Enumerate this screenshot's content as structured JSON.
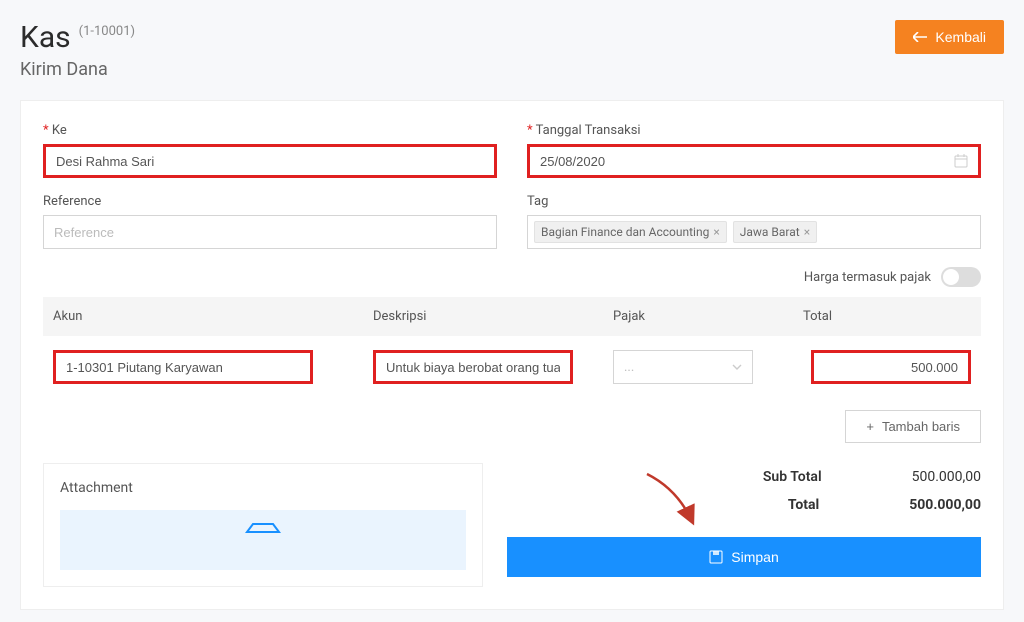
{
  "header": {
    "title": "Kas",
    "code": "(1-10001)",
    "subtitle": "Kirim Dana",
    "back_label": "Kembali"
  },
  "form": {
    "ke_label": "Ke",
    "ke_value": "Desi Rahma Sari",
    "tanggal_label": "Tanggal Transaksi",
    "tanggal_value": "25/08/2020",
    "reference_label": "Reference",
    "reference_placeholder": "Reference",
    "tag_label": "Tag",
    "tags": [
      "Bagian Finance dan Accounting",
      "Jawa Barat"
    ]
  },
  "toggle": {
    "label": "Harga termasuk pajak"
  },
  "table": {
    "head": {
      "akun": "Akun",
      "deskripsi": "Deskripsi",
      "pajak": "Pajak",
      "total": "Total"
    },
    "row": {
      "akun": "1-10301 Piutang Karyawan",
      "deskripsi": "Untuk biaya berobat orang tua",
      "pajak_placeholder": "...",
      "total": "500.000"
    },
    "add_row": "Tambah baris"
  },
  "attachment": {
    "title": "Attachment"
  },
  "totals": {
    "subtotal_label": "Sub Total",
    "subtotal_value": "500.000,00",
    "total_label": "Total",
    "total_value": "500.000,00"
  },
  "save_label": "Simpan"
}
